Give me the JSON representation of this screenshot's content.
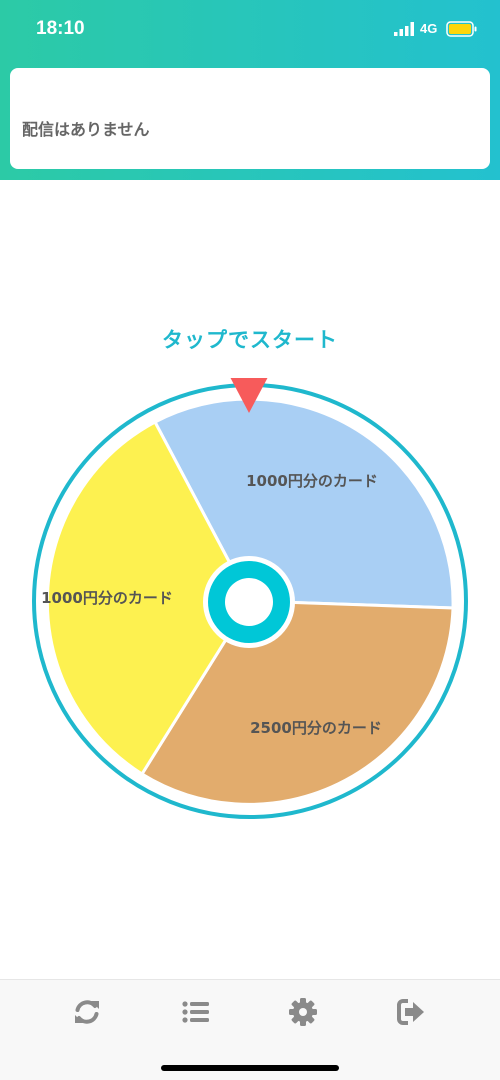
{
  "status_bar": {
    "time": "18:10",
    "network": "4G",
    "signal_icon": "signal-bars-icon",
    "battery_icon": "battery-icon",
    "battery_color": "#ffd60a"
  },
  "notice": {
    "text": "配信はありません"
  },
  "roulette": {
    "start_label": "タップでスタート",
    "pointer_icon": "triangle-pointer-icon",
    "segments": [
      {
        "label": "1000円分のカード",
        "color": "#a9cff4"
      },
      {
        "label": "2500円分のカード",
        "color": "#e2ac6d"
      },
      {
        "label": "1000円分のカード",
        "color": "#fdf150"
      }
    ],
    "colors": {
      "ring": "#1fb8cd",
      "hub": "#00c7d7",
      "pointer": "#f75b5b"
    }
  },
  "tabbar": {
    "items": [
      {
        "name": "refresh",
        "icon": "refresh-icon"
      },
      {
        "name": "list",
        "icon": "list-icon"
      },
      {
        "name": "settings",
        "icon": "gear-icon"
      },
      {
        "name": "logout",
        "icon": "logout-icon"
      }
    ],
    "icon_color": "#8a8a8a"
  }
}
